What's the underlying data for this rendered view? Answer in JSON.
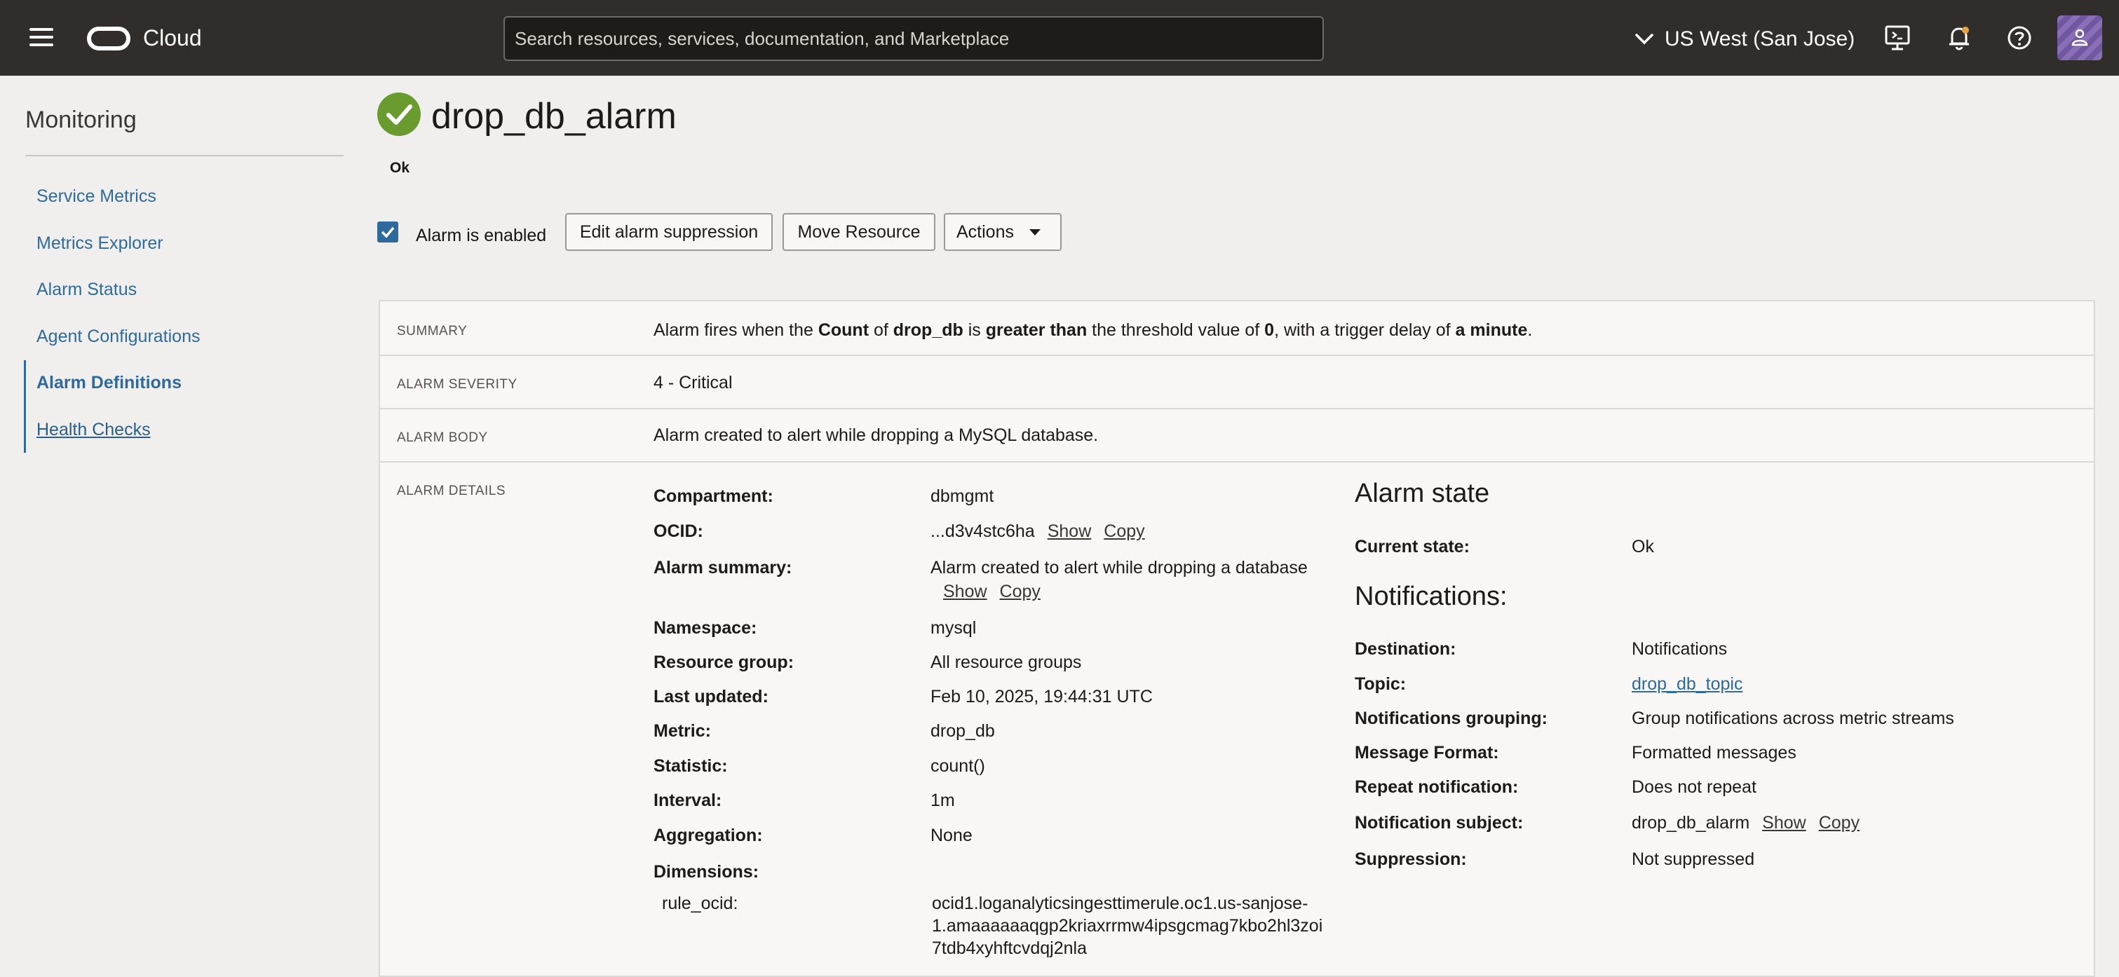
{
  "header": {
    "brand": "Cloud",
    "search_placeholder": "Search resources, services, documentation, and Marketplace",
    "region": "US West (San Jose)"
  },
  "sidebar": {
    "title": "Monitoring",
    "items": [
      {
        "label": "Service Metrics"
      },
      {
        "label": "Metrics Explorer"
      },
      {
        "label": "Alarm Status"
      },
      {
        "label": "Agent Configurations"
      },
      {
        "label": "Alarm Definitions"
      },
      {
        "label": "Health Checks"
      }
    ]
  },
  "page": {
    "title": "drop_db_alarm",
    "status": "Ok",
    "enabled_label": "Alarm is enabled",
    "buttons": {
      "edit_suppression": "Edit alarm suppression",
      "move_resource": "Move Resource",
      "actions": "Actions"
    }
  },
  "summary": {
    "label": "SUMMARY",
    "parts": {
      "p1": "Alarm fires when the ",
      "b1": "Count",
      "p2": " of ",
      "b2": "drop_db",
      "p3": " is ",
      "b3": "greater than",
      "p4": " the threshold value of ",
      "b4": "0",
      "p5": ", with a trigger delay of ",
      "b5": "a minute",
      "p6": "."
    }
  },
  "severity": {
    "label": "ALARM SEVERITY",
    "value": "4 - Critical"
  },
  "body": {
    "label": "ALARM BODY",
    "value": "Alarm created to alert while dropping a MySQL database."
  },
  "details": {
    "label": "ALARM DETAILS",
    "compartment": {
      "key": "Compartment:",
      "value": "dbmgmt"
    },
    "ocid": {
      "key": "OCID:",
      "value": "...d3v4stc6ha",
      "show": "Show",
      "copy": "Copy"
    },
    "alarm_summary": {
      "key": "Alarm summary:",
      "value": "Alarm created to alert while dropping a database",
      "show": "Show",
      "copy": "Copy"
    },
    "namespace": {
      "key": "Namespace:",
      "value": "mysql"
    },
    "resource_group": {
      "key": "Resource group:",
      "value": "All resource groups"
    },
    "last_updated": {
      "key": "Last updated:",
      "value": "Feb 10, 2025, 19:44:31 UTC"
    },
    "metric": {
      "key": "Metric:",
      "value": "drop_db"
    },
    "statistic": {
      "key": "Statistic:",
      "value": "count()"
    },
    "interval": {
      "key": "Interval:",
      "value": "1m"
    },
    "aggregation": {
      "key": "Aggregation:",
      "value": "None"
    },
    "dimensions": {
      "key": "Dimensions:"
    },
    "rule_ocid": {
      "key": "rule_ocid:",
      "line1": "ocid1.loganalyticsingesttimerule.oc1.us-sanjose-",
      "line2": "1.amaaaaaaqgp2kriaxrrmw4ipsgcmag7kbo2hl3zoi",
      "line3": "7tdb4xyhftcvdqj2nla"
    }
  },
  "alarm_state": {
    "title": "Alarm state",
    "current_state": {
      "key": "Current state:",
      "value": "Ok"
    }
  },
  "notifications": {
    "title": "Notifications:",
    "destination": {
      "key": "Destination:",
      "value": "Notifications"
    },
    "topic": {
      "key": "Topic:",
      "value": "drop_db_topic"
    },
    "grouping": {
      "key": "Notifications grouping:",
      "value": "Group notifications across metric streams"
    },
    "format": {
      "key": "Message Format:",
      "value": "Formatted messages"
    },
    "repeat": {
      "key": "Repeat notification:",
      "value": "Does not repeat"
    },
    "subject": {
      "key": "Notification subject:",
      "value": "drop_db_alarm",
      "show": "Show",
      "copy": "Copy"
    },
    "suppression": {
      "key": "Suppression:",
      "value": "Not suppressed"
    }
  },
  "colors": {
    "header_bg": "#312d2a",
    "link": "#2e6b9c",
    "ok_green": "#6a9b2f"
  }
}
